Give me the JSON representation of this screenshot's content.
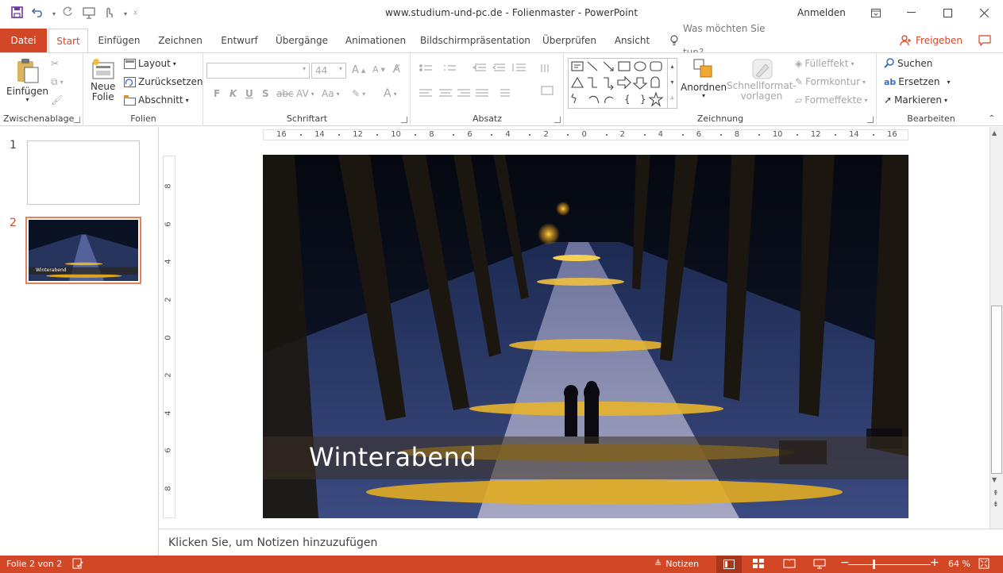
{
  "window": {
    "title": "www.studium-und-pc.de - Folienmaster  -  PowerPoint",
    "signin": "Anmelden"
  },
  "tabs": [
    "Datei",
    "Start",
    "Einfügen",
    "Zeichnen",
    "Entwurf",
    "Übergänge",
    "Animationen",
    "Bildschirmpräsentation",
    "Überprüfen",
    "Ansicht"
  ],
  "tell_me": "Was möchten Sie tun?",
  "share": "Freigeben",
  "ribbon": {
    "clipboard": {
      "label": "Zwischenablage",
      "paste": "Einfügen"
    },
    "slides": {
      "label": "Folien",
      "new_slide_1": "Neue",
      "new_slide_2": "Folie",
      "layout": "Layout",
      "reset": "Zurücksetzen",
      "section": "Abschnitt"
    },
    "font": {
      "label": "Schriftart",
      "size": "44",
      "bold": "F",
      "italic": "K",
      "underline": "U",
      "shadow": "S",
      "strike": "abc",
      "spacing": "AV",
      "case": "Aa"
    },
    "paragraph": {
      "label": "Absatz"
    },
    "drawing": {
      "label": "Zeichnung",
      "arrange": "Anordnen",
      "quick_styles_1": "Schnellformat-",
      "quick_styles_2": "vorlagen",
      "fill": "Fülleffekt",
      "outline": "Formkontur",
      "effects": "Formeffekte"
    },
    "editing": {
      "label": "Bearbeiten",
      "find": "Suchen",
      "replace": "Ersetzen",
      "select": "Markieren"
    }
  },
  "ruler": {
    "h": [
      "16",
      "14",
      "12",
      "10",
      "8",
      "6",
      "4",
      "2",
      "0",
      "2",
      "4",
      "6",
      "8",
      "10",
      "12",
      "14",
      "16"
    ],
    "v": [
      "8",
      "6",
      "4",
      "2",
      "0",
      "2",
      "4",
      "6",
      "8"
    ]
  },
  "thumbnails": [
    {
      "number": "1",
      "title": ""
    },
    {
      "number": "2",
      "title": "Winterabend"
    }
  ],
  "slide": {
    "title": "Winterabend"
  },
  "notes": {
    "placeholder": "Klicken Sie, um Notizen hinzuzufügen"
  },
  "status": {
    "slide_info": "Folie 2 von 2",
    "notes_btn": "Notizen",
    "zoom": "64 %",
    "zoom_level": 0.64
  },
  "colors": {
    "accent": "#d24726"
  }
}
